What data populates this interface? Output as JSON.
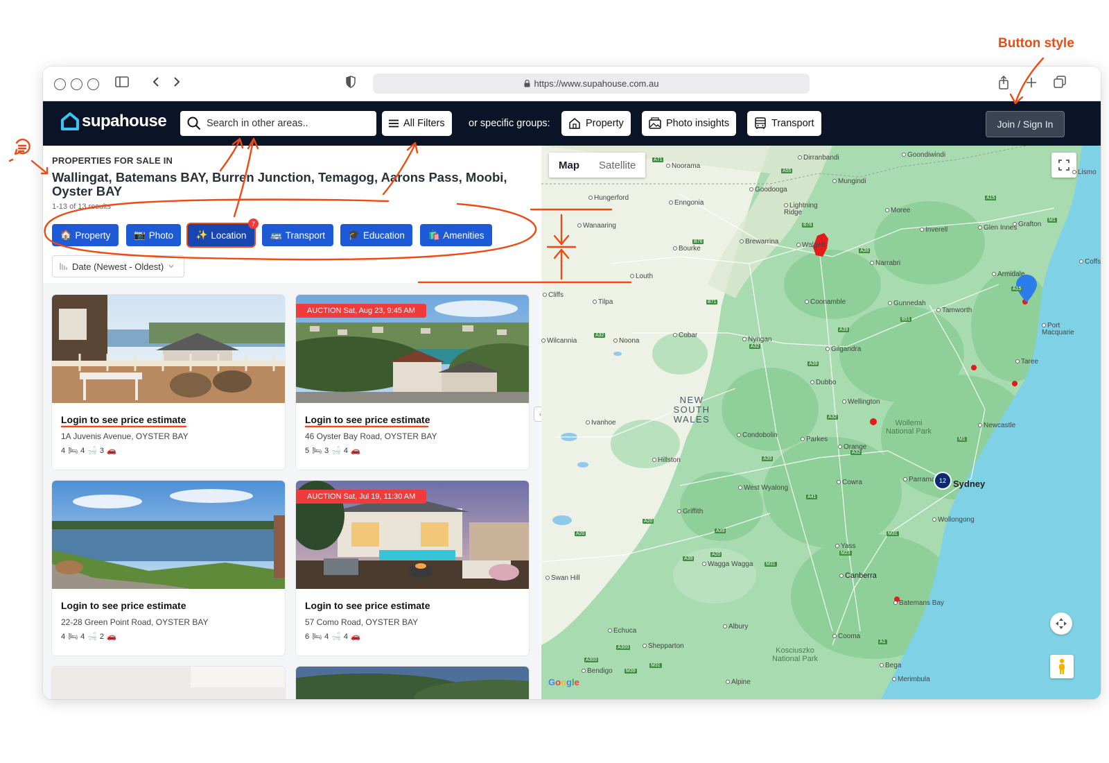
{
  "annotation": {
    "button_style_note": "Button style"
  },
  "browser": {
    "url": "https://www.supahouse.com.au"
  },
  "header": {
    "logo_text": "supahouse",
    "search_placeholder": "Search in other areas..",
    "all_filters_label": "All Filters",
    "groups_label": "or specific groups:",
    "group_buttons": [
      "Property",
      "Photo insights",
      "Transport"
    ],
    "join_label": "Join / Sign In"
  },
  "listing": {
    "eyebrow": "PROPERTIES FOR SALE IN",
    "areas": "Wallingat, Batemans BAY, Burren Junction, Temagog, Aarons Pass, Moobi, Oyster BAY",
    "results": "1-13 of 13 results",
    "chips": [
      {
        "icon": "🏠",
        "label": "Property"
      },
      {
        "icon": "📷",
        "label": "Photo"
      },
      {
        "icon": "✨",
        "label": "Location",
        "badge": "7"
      },
      {
        "icon": "🚌",
        "label": "Transport"
      },
      {
        "icon": "🎓",
        "label": "Education"
      },
      {
        "icon": "🛍️",
        "label": "Amenities"
      }
    ],
    "sort_label": "Date (Newest - Oldest)",
    "cards": [
      {
        "price": "Login to see price estimate",
        "address": "1A Juvenis Avenue, OYSTER BAY",
        "beds": "4",
        "baths": "4",
        "cars": "3",
        "auction": ""
      },
      {
        "price": "Login to see price estimate",
        "address": "46 Oyster Bay Road, OYSTER BAY",
        "beds": "5",
        "baths": "3",
        "cars": "4",
        "auction": "AUCTION Sat, Aug 23, 9:45 AM"
      },
      {
        "price": "Login to see price estimate",
        "address": "22-28 Green Point Road, OYSTER BAY",
        "beds": "4",
        "baths": "4",
        "cars": "2",
        "auction": ""
      },
      {
        "price": "Login to see price estimate",
        "address": "57 Como Road, OYSTER BAY",
        "beds": "6",
        "baths": "4",
        "cars": "4",
        "auction": "AUCTION Sat, Jul 19, 11:30 AM"
      }
    ]
  },
  "map": {
    "tabs": [
      "Map",
      "Satellite"
    ],
    "state_label": "NEW SOUTH WALES",
    "cluster_count": "12",
    "city": "Sydney",
    "parks": [
      "Wollemi National Park",
      "Kosciuszko National Park"
    ],
    "towns": [
      "Noorama",
      "Dirranbandi",
      "Goondiwindi",
      "Mungindi",
      "Goodooga",
      "Lightning Ridge",
      "Hungerford",
      "Enngonia",
      "Moree",
      "Inverell",
      "Glen Innes",
      "Grafton",
      "Wanaaring",
      "Bourke",
      "Brewarrina",
      "Walgett",
      "Narrabri",
      "Armidale",
      "Coffs H",
      "Louth",
      "Tilpa",
      "Coonamble",
      "Gunnedah",
      "Tamworth",
      "Port Macquarie",
      "Cobar",
      "Nyngan",
      "Gilgandra",
      "Noona",
      "Wilcannia",
      "Taree",
      "Dubbo",
      "Wellington",
      "Ivanhoe",
      "Condobolin",
      "Parkes",
      "Orange",
      "Newcastle",
      "Hillston",
      "Cowra",
      "Parramatta",
      "West Wyalong",
      "Wollongong",
      "Griffith",
      "Yass",
      "Canberra",
      "Wagga Wagga",
      "Swan Hill",
      "Batemans Bay",
      "Albury",
      "Cooma",
      "Echuca",
      "Shepparton",
      "Bendigo",
      "Bega",
      "Merimbula",
      "Alpine",
      "Cliffs",
      "Lismo"
    ]
  }
}
